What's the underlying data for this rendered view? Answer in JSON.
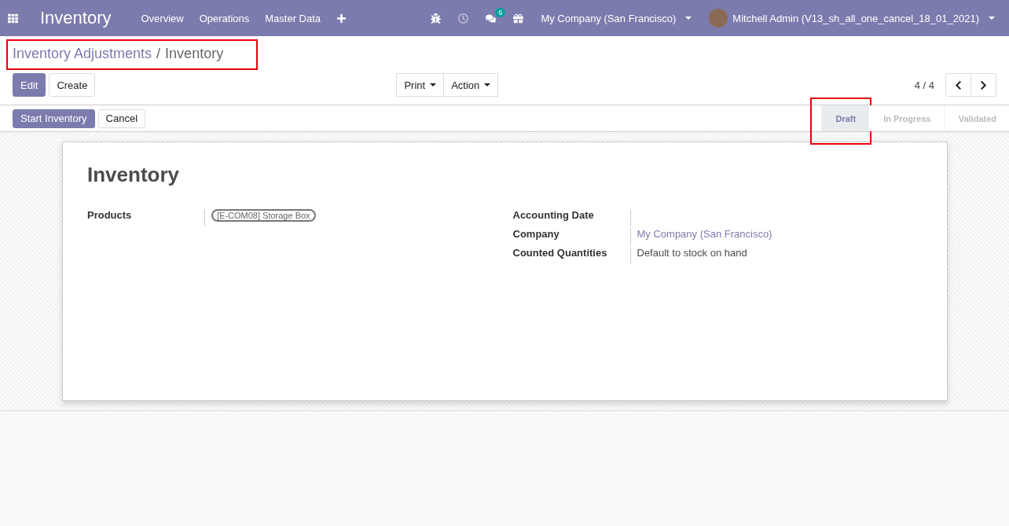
{
  "navbar": {
    "app_title": "Inventory",
    "menu": [
      "Overview",
      "Operations",
      "Master Data"
    ],
    "chat_count": "6",
    "company": "My Company (San Francisco)",
    "user": "Mitchell Admin (V13_sh_all_one_cancel_18_01_2021)"
  },
  "breadcrumb": {
    "parent": "Inventory Adjustments",
    "separator": "/",
    "current": "Inventory",
    "highlighted": true
  },
  "buttons": {
    "edit": "Edit",
    "create": "Create",
    "print": "Print",
    "action": "Action"
  },
  "pager": "4 / 4",
  "status_buttons": [
    "Start Inventory",
    "Cancel"
  ],
  "stages": [
    {
      "label": "Draft",
      "selected": true,
      "highlighted": true
    },
    {
      "label": "In Progress",
      "selected": false,
      "highlighted": false
    },
    {
      "label": "Validated",
      "selected": false,
      "highlighted": false
    }
  ],
  "form": {
    "title": "Inventory",
    "left": [
      {
        "label": "Products",
        "kind": "tag",
        "value": "[E-COM08] Storage Box"
      }
    ],
    "right": [
      {
        "label": "Accounting Date",
        "kind": "text"
      },
      {
        "label": "Company",
        "kind": "link",
        "value": "My Company (San Francisco)"
      },
      {
        "label": "Counted Quantities",
        "kind": "text",
        "value": "Default to stock on hand"
      }
    ]
  }
}
